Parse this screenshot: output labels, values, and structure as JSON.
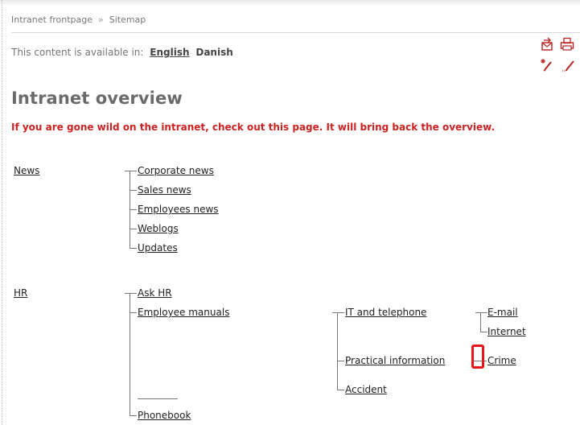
{
  "breadcrumb": {
    "items": [
      "Intranet frontpage",
      "Sitemap"
    ],
    "separator": "»"
  },
  "language": {
    "prefix": "This content is available in:",
    "current": "English",
    "other": "Danish"
  },
  "toolbar": {
    "icons": [
      "send-page-icon",
      "print-icon",
      "new-page-icon",
      "edit-page-icon"
    ]
  },
  "page": {
    "title": "Intranet overview",
    "intro": "If you are gone wild on the intranet, check out this page. It will bring back the overview."
  },
  "sitemap": {
    "news": {
      "label": "News",
      "children": [
        "Corporate news",
        "Sales news",
        "Employees news",
        "Weblogs",
        "Updates"
      ]
    },
    "hr": {
      "label": "HR",
      "children": [
        "Ask HR",
        "Employee manuals",
        "Phonebook"
      ],
      "manuals": [
        "IT and telephone",
        "Practical information",
        "Accident"
      ],
      "it": [
        "E-mail",
        "Internet"
      ],
      "practical": [
        "Crime"
      ]
    }
  },
  "colors": {
    "accent_red": "#cc2222",
    "highlight": "#e8141b",
    "title_gray": "#6a6a6a"
  }
}
